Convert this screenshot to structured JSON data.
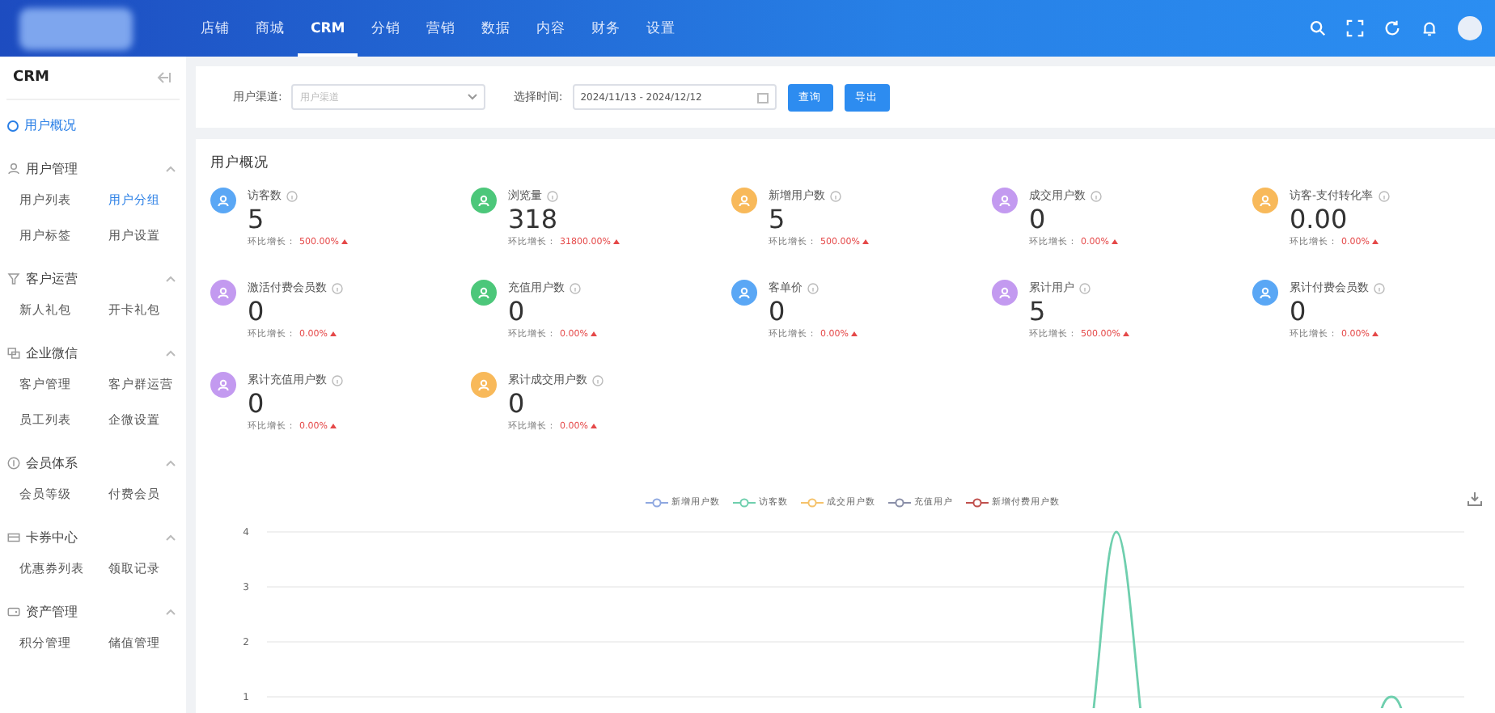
{
  "top_nav": {
    "items": [
      {
        "label": "店铺",
        "selected": false
      },
      {
        "label": "商城",
        "selected": false
      },
      {
        "label": "CRM",
        "selected": true
      },
      {
        "label": "分销",
        "selected": false
      },
      {
        "label": "营销",
        "selected": false
      },
      {
        "label": "数据",
        "selected": false
      },
      {
        "label": "内容",
        "selected": false
      },
      {
        "label": "财务",
        "selected": false
      },
      {
        "label": "设置",
        "selected": false
      }
    ]
  },
  "sidebar": {
    "title": "CRM",
    "overview": {
      "label": "用户概况",
      "selected": true
    },
    "groups": [
      {
        "title": "用户管理",
        "expanded": true,
        "items": [
          {
            "label": "用户列表",
            "selected": false
          },
          {
            "label": "用户分组",
            "selected": true
          },
          {
            "label": "用户标签",
            "selected": false
          },
          {
            "label": "用户设置",
            "selected": false
          }
        ]
      },
      {
        "title": "客户运营",
        "expanded": true,
        "items": [
          {
            "label": "新人礼包",
            "selected": false
          },
          {
            "label": "开卡礼包",
            "selected": false
          }
        ]
      },
      {
        "title": "企业微信",
        "expanded": true,
        "items": [
          {
            "label": "客户管理",
            "selected": false
          },
          {
            "label": "客户群运营",
            "selected": false
          },
          {
            "label": "员工列表",
            "selected": false
          },
          {
            "label": "企微设置",
            "selected": false
          }
        ]
      },
      {
        "title": "会员体系",
        "expanded": true,
        "items": [
          {
            "label": "会员等级",
            "selected": false
          },
          {
            "label": "付费会员",
            "selected": false
          }
        ]
      },
      {
        "title": "卡券中心",
        "expanded": true,
        "items": [
          {
            "label": "优惠券列表",
            "selected": false
          },
          {
            "label": "领取记录",
            "selected": false
          }
        ]
      },
      {
        "title": "资产管理",
        "expanded": true,
        "items": [
          {
            "label": "积分管理",
            "selected": false
          },
          {
            "label": "储值管理",
            "selected": false
          }
        ]
      }
    ]
  },
  "filters": {
    "channel_label": "用户渠道:",
    "channel_placeholder": "用户渠道",
    "time_label": "选择时间:",
    "date_range": "2024/11/13 - 2024/12/12",
    "buttons": [
      "查询",
      "导出"
    ]
  },
  "overview": {
    "title": "用户概况",
    "stats": [
      {
        "label": "访客数",
        "value": "5",
        "growth_label": "环比增长：",
        "growth": "500.00%",
        "color": "#5aa7f5"
      },
      {
        "label": "浏览量",
        "value": "318",
        "growth_label": "环比增长：",
        "growth": "31800.00%",
        "color": "#4cc77a"
      },
      {
        "label": "新增用户数",
        "value": "5",
        "growth_label": "环比增长：",
        "growth": "500.00%",
        "color": "#f8b95a"
      },
      {
        "label": "成交用户数",
        "value": "0",
        "growth_label": "环比增长：",
        "growth": "0.00%",
        "color": "#c39af0"
      },
      {
        "label": "访客-支付转化率",
        "value": "0.00",
        "growth_label": "环比增长：",
        "growth": "0.00%",
        "color": "#f8b95a"
      },
      {
        "label": "激活付费会员数",
        "value": "0",
        "growth_label": "环比增长：",
        "growth": "0.00%",
        "color": "#c39af0"
      },
      {
        "label": "充值用户数",
        "value": "0",
        "growth_label": "环比增长：",
        "growth": "0.00%",
        "color": "#4cc77a"
      },
      {
        "label": "客单价",
        "value": "0",
        "growth_label": "环比增长：",
        "growth": "0.00%",
        "color": "#5aa7f5"
      },
      {
        "label": "累计用户",
        "value": "5",
        "growth_label": "环比增长：",
        "growth": "500.00%",
        "color": "#c39af0"
      },
      {
        "label": "累计付费会员数",
        "value": "0",
        "growth_label": "环比增长：",
        "growth": "0.00%",
        "color": "#5aa7f5"
      },
      {
        "label": "累计充值用户数",
        "value": "0",
        "growth_label": "环比增长：",
        "growth": "0.00%",
        "color": "#c39af0"
      },
      {
        "label": "累计成交用户数",
        "value": "0",
        "growth_label": "环比增长：",
        "growth": "0.00%",
        "color": "#f8b95a"
      }
    ],
    "chart": {
      "legend": [
        {
          "name": "新增用户数",
          "color": "#8fa8e0"
        },
        {
          "name": "访客数",
          "color": "#6fcfae"
        },
        {
          "name": "成交用户数",
          "color": "#f5c26b"
        },
        {
          "name": "充值用户",
          "color": "#8a8fa8"
        },
        {
          "name": "新增付费用户数",
          "color": "#c0504d"
        }
      ],
      "y_axis_labels": [
        "4",
        "3",
        "2",
        "1"
      ]
    }
  }
}
